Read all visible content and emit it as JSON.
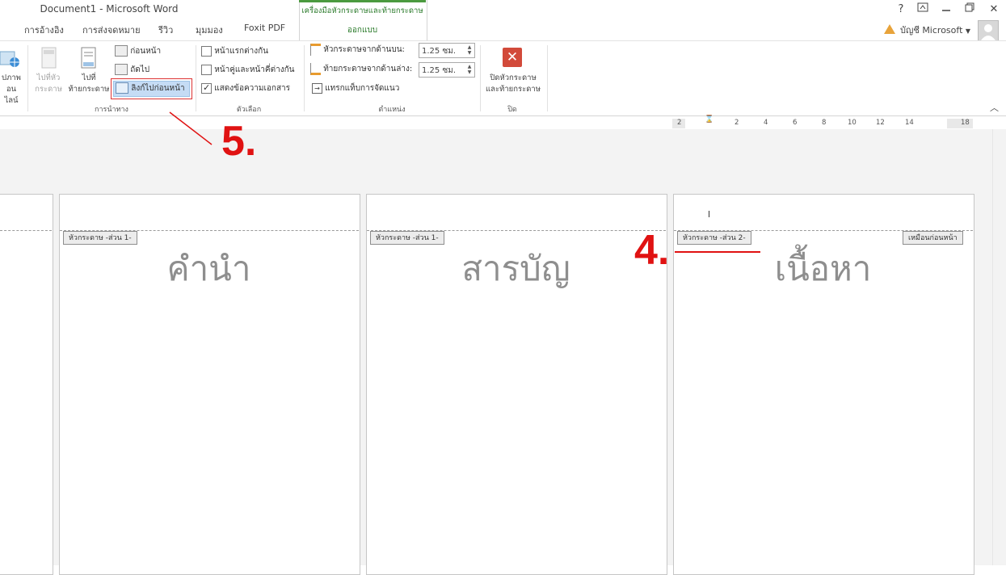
{
  "window": {
    "title": "Document1 - Microsoft Word",
    "help_label": "?",
    "restore_label": "🗗",
    "minimize_label": "▁",
    "maximize_label": "🗖",
    "close_label": "✕"
  },
  "tabs": [
    "การอ้างอิง",
    "การส่งจดหมาย",
    "รีวิว",
    "มุมมอง",
    "Foxit PDF"
  ],
  "contextual": {
    "group_label": "เครื่องมือหัวกระดาษและท้ายกระดาษ",
    "tab_label": "ออกแบบ"
  },
  "account": {
    "label": "บัญชี Microsoft"
  },
  "ribbon": {
    "insert_group": {
      "partial_label_1": "ปภาพ",
      "partial_label_2": "อนไลน์"
    },
    "navigation": {
      "go_to_header_1": "ไปที่หัว",
      "go_to_header_2": "กระดาษ",
      "go_to_footer_1": "ไปที่",
      "go_to_footer_2": "ท้ายกระดาษ",
      "previous": "ก่อนหน้า",
      "next": "ถัดไป",
      "link_to_previous": "ลิงก์ไปก่อนหน้า",
      "group_label": "การนำทาง"
    },
    "options": {
      "different_first_page": "หน้าแรกต่างกัน",
      "different_odd_even": "หน้าคู่และหน้าคี่ต่างกัน",
      "show_document_text": "แสดงข้อความเอกสาร",
      "group_label": "ตัวเลือก",
      "different_first_page_checked": false,
      "different_odd_even_checked": false,
      "show_document_text_checked": true
    },
    "position": {
      "header_from_top": "หัวกระดาษจากด้านบน:",
      "footer_from_bottom": "ท้ายกระดาษจากด้านล่าง:",
      "header_value": "1.25 ซม.",
      "footer_value": "1.25 ซม.",
      "insert_alignment_tab": "แทรกแท็บการจัดแนว",
      "group_label": "ตำแหน่ง"
    },
    "close": {
      "label_1": "ปิดหัวกระดาษ",
      "label_2": "และท้ายกระดาษ",
      "group_label": "ปิด"
    }
  },
  "ruler": [
    "2",
    "2",
    "4",
    "6",
    "8",
    "10",
    "12",
    "14",
    "18"
  ],
  "pages": [
    {
      "header_tag": "หัวกระดาษ -ส่วน 1-",
      "text": "คำนำ"
    },
    {
      "header_tag": "หัวกระดาษ -ส่วน 1-",
      "text": "สารบัญ"
    },
    {
      "header_tag": "หัวกระดาษ -ส่วน 2-",
      "text": "เนื้อหา",
      "same_as_previous": "เหมือนก่อนหน้า"
    }
  ],
  "annotations": {
    "step5": "5.",
    "step4": "4."
  },
  "colors": {
    "accent_green": "#4b9a3f",
    "annotation_red": "#e01212",
    "close_red": "#d24a3a"
  }
}
